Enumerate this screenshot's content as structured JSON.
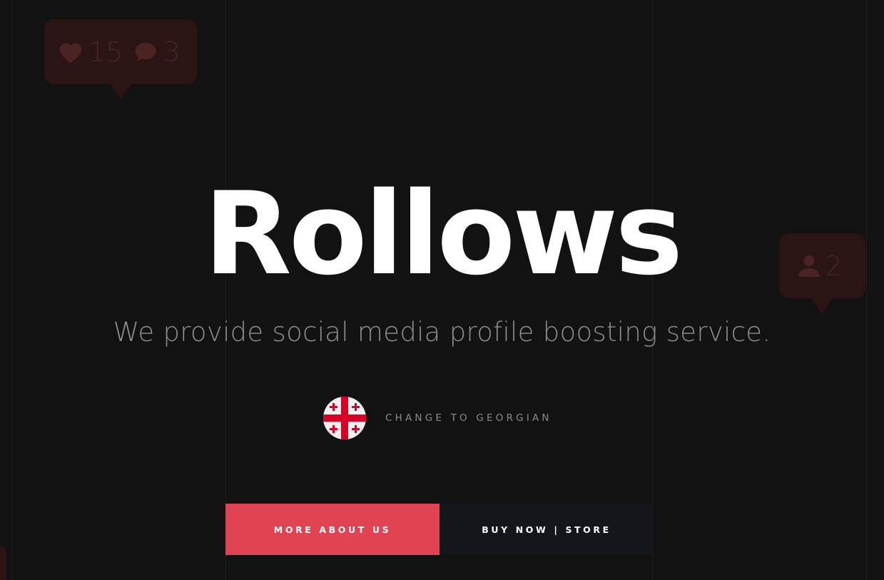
{
  "hero": {
    "title": "Rollows",
    "subtitle": "We provide social media profile boosting service."
  },
  "language": {
    "label": "CHANGE TO GEORGIAN",
    "flag_icon": "georgia-flag-icon"
  },
  "buttons": {
    "primary_label": "MORE ABOUT US",
    "secondary_label": "BUY NOW | STORE"
  },
  "decor": {
    "likes_count": "15",
    "comments_count": "3",
    "followers_count": "2"
  },
  "colors": {
    "background": "#121212",
    "accent": "#e24352",
    "dark_button": "#13161b",
    "bubble": "#2a1414"
  }
}
